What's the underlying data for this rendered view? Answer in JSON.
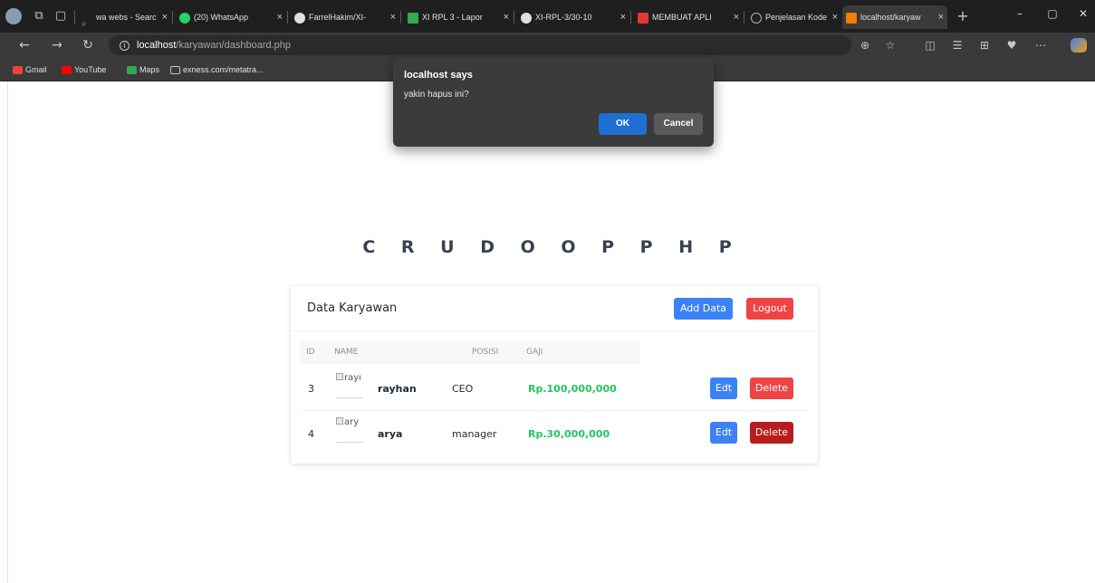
{
  "browser": {
    "tabs": [
      {
        "label": "wa webs - Searc",
        "icon": "search-icon",
        "color": "#9aa0a6"
      },
      {
        "label": "(20) WhatsApp",
        "icon": "whatsapp-icon",
        "color": "#25d366"
      },
      {
        "label": "FarrelHakim/XI-",
        "icon": "github-icon",
        "color": "#e0e0e0"
      },
      {
        "label": "XI RPL 3 - Lapor",
        "icon": "drive-icon",
        "color": "#34a853"
      },
      {
        "label": "XI-RPL-3/30-10",
        "icon": "github-icon",
        "color": "#e0e0e0"
      },
      {
        "label": "MEMBUAT APLI",
        "icon": "youtube-icon",
        "color": "#e53935"
      },
      {
        "label": "Penjelasan Kode",
        "icon": "globe-icon",
        "color": "#b0b0b0"
      },
      {
        "label": "localhost/karyaw",
        "icon": "xampp-icon",
        "color": "#f57c00"
      }
    ],
    "address": {
      "host": "localhost",
      "path": "/karyawan/dashboard.php"
    },
    "bookmarks": [
      {
        "label": "Gmail",
        "color": "#ea4335"
      },
      {
        "label": "YouTube",
        "color": "#ff0000"
      },
      {
        "label": "Maps",
        "color": "#34a853"
      },
      {
        "label": "exness.com/metatra...",
        "color": "#c8c8c8"
      }
    ]
  },
  "page": {
    "title": "C R U D   O O P   P H P",
    "card": {
      "title": "Data Karyawan",
      "add_label": "Add Data",
      "logout_label": "Logout",
      "columns": [
        "ID",
        "NAME",
        "POSISI",
        "GAJI"
      ],
      "rows": [
        {
          "id": "3",
          "img_alt": "rayı",
          "name": "rayhan",
          "posisi": "CEO",
          "gaji": "Rp.100,000,000",
          "edit_label": "Edt",
          "delete_label": "Delete"
        },
        {
          "id": "4",
          "img_alt": "ary",
          "name": "arya",
          "posisi": "manager",
          "gaji": "Rp.30,000,000",
          "edit_label": "Edt",
          "delete_label": "Delete"
        }
      ]
    }
  },
  "dialog": {
    "title": "localhost says",
    "message": "yakin hapus ini?",
    "ok_label": "OK",
    "cancel_label": "Cancel"
  }
}
